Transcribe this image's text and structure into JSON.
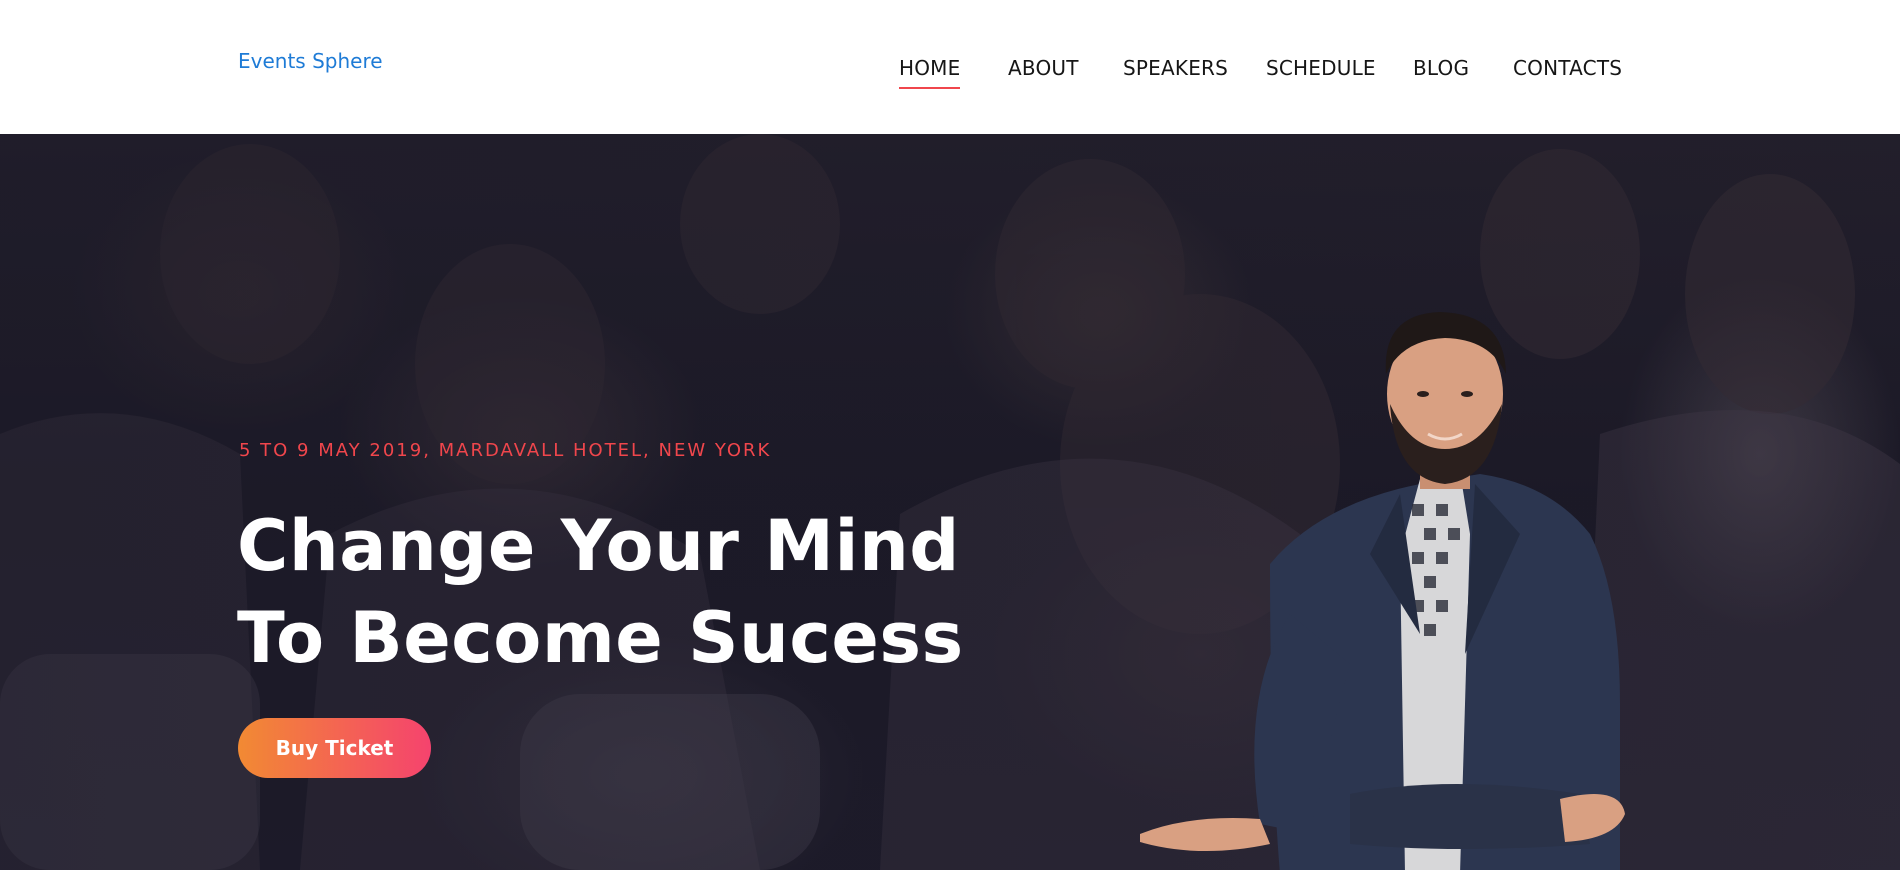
{
  "header": {
    "logo": "Events Sphere",
    "nav": [
      {
        "label": "HOME",
        "active": true
      },
      {
        "label": "ABOUT",
        "active": false
      },
      {
        "label": "SPEAKERS",
        "active": false
      },
      {
        "label": "SCHEDULE",
        "active": false
      },
      {
        "label": "BLOG",
        "active": false
      },
      {
        "label": "CONTACTS",
        "active": false
      }
    ]
  },
  "hero": {
    "event_meta": "5 TO 9 MAY 2019, MARDAVALL HOTEL, NEW YORK",
    "title_line1": "Change Your Mind",
    "title_line2": "To Become Sucess",
    "cta_label": "Buy Ticket",
    "background": "audience-photo",
    "speaker_image": "speaker-photo"
  },
  "colors": {
    "accent": "#f0464c",
    "logo": "#1e7bd6",
    "button_gradient_start": "#f28a33",
    "button_gradient_end": "#f5436e",
    "hero_bg": "#1b1926"
  }
}
